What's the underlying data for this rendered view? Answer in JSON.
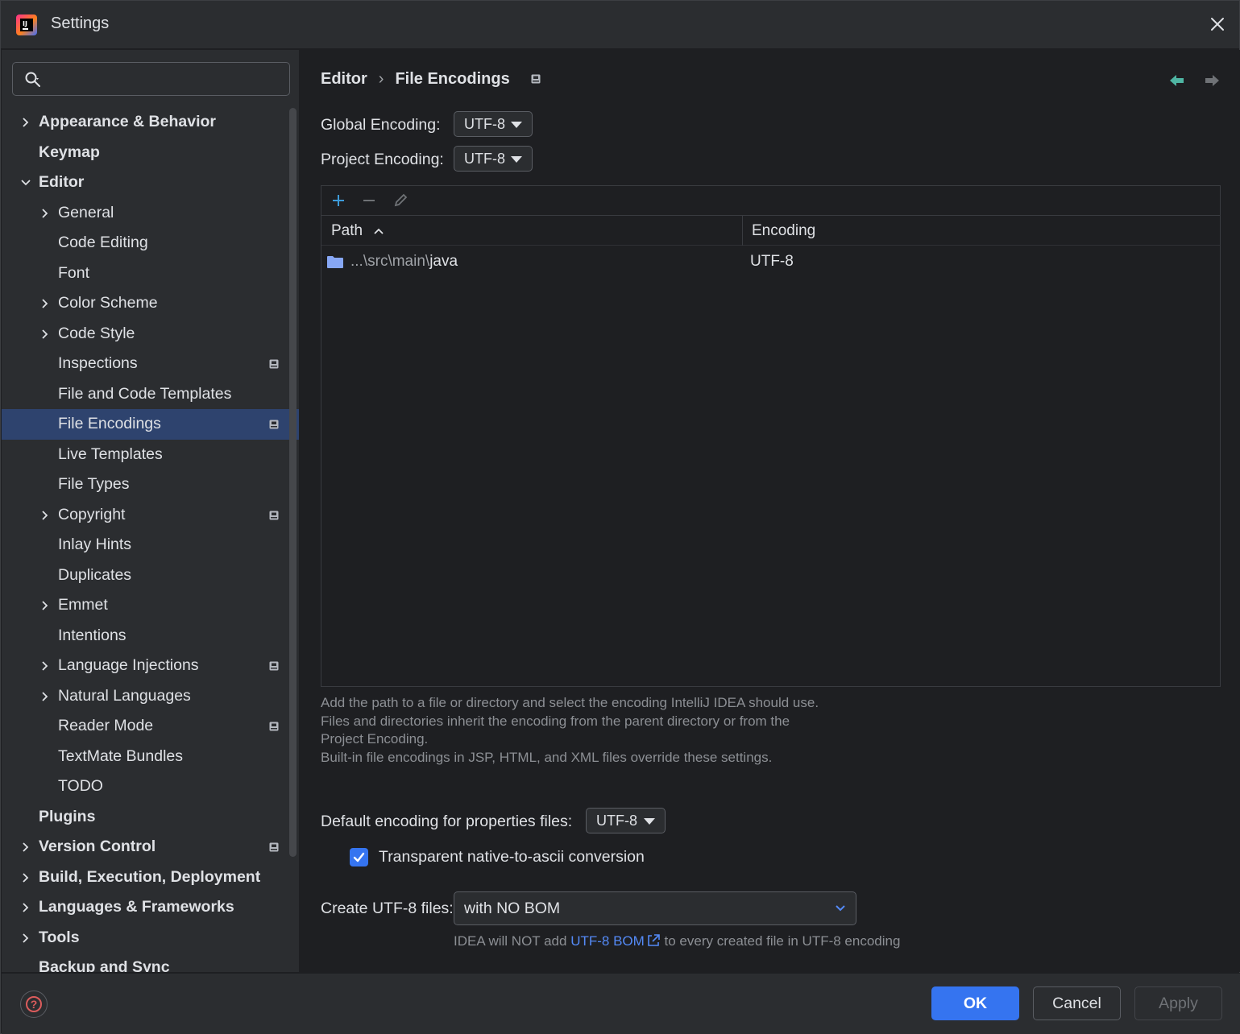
{
  "window": {
    "title": "Settings"
  },
  "search": {
    "placeholder": ""
  },
  "sidebar": {
    "items": [
      {
        "label": "Appearance & Behavior",
        "level": 0,
        "expander": "collapsed",
        "project": false
      },
      {
        "label": "Keymap",
        "level": 0,
        "expander": "none",
        "project": false
      },
      {
        "label": "Editor",
        "level": 0,
        "expander": "expanded",
        "project": false
      },
      {
        "label": "General",
        "level": 1,
        "expander": "collapsed",
        "project": false
      },
      {
        "label": "Code Editing",
        "level": 1,
        "expander": "none",
        "project": false
      },
      {
        "label": "Font",
        "level": 1,
        "expander": "none",
        "project": false
      },
      {
        "label": "Color Scheme",
        "level": 1,
        "expander": "collapsed",
        "project": false
      },
      {
        "label": "Code Style",
        "level": 1,
        "expander": "collapsed",
        "project": false
      },
      {
        "label": "Inspections",
        "level": 1,
        "expander": "none",
        "project": true
      },
      {
        "label": "File and Code Templates",
        "level": 1,
        "expander": "none",
        "project": false
      },
      {
        "label": "File Encodings",
        "level": 1,
        "expander": "none",
        "project": true,
        "selected": true
      },
      {
        "label": "Live Templates",
        "level": 1,
        "expander": "none",
        "project": false
      },
      {
        "label": "File Types",
        "level": 1,
        "expander": "none",
        "project": false
      },
      {
        "label": "Copyright",
        "level": 1,
        "expander": "collapsed",
        "project": true
      },
      {
        "label": "Inlay Hints",
        "level": 1,
        "expander": "none",
        "project": false
      },
      {
        "label": "Duplicates",
        "level": 1,
        "expander": "none",
        "project": false
      },
      {
        "label": "Emmet",
        "level": 1,
        "expander": "collapsed",
        "project": false
      },
      {
        "label": "Intentions",
        "level": 1,
        "expander": "none",
        "project": false
      },
      {
        "label": "Language Injections",
        "level": 1,
        "expander": "collapsed",
        "project": true
      },
      {
        "label": "Natural Languages",
        "level": 1,
        "expander": "collapsed",
        "project": false
      },
      {
        "label": "Reader Mode",
        "level": 1,
        "expander": "none",
        "project": true
      },
      {
        "label": "TextMate Bundles",
        "level": 1,
        "expander": "none",
        "project": false
      },
      {
        "label": "TODO",
        "level": 1,
        "expander": "none",
        "project": false
      },
      {
        "label": "Plugins",
        "level": 0,
        "expander": "none",
        "project": false
      },
      {
        "label": "Version Control",
        "level": 0,
        "expander": "collapsed",
        "project": true
      },
      {
        "label": "Build, Execution, Deployment",
        "level": 0,
        "expander": "collapsed",
        "project": false
      },
      {
        "label": "Languages & Frameworks",
        "level": 0,
        "expander": "collapsed",
        "project": false
      },
      {
        "label": "Tools",
        "level": 0,
        "expander": "collapsed",
        "project": false
      },
      {
        "label": "Backup and Sync",
        "level": 0,
        "expander": "none",
        "project": false
      }
    ]
  },
  "breadcrumb": {
    "parent": "Editor",
    "current": "File Encodings"
  },
  "global_encoding": {
    "label": "Global Encoding:",
    "value": "UTF-8"
  },
  "project_encoding": {
    "label": "Project Encoding:",
    "value": "UTF-8"
  },
  "table": {
    "columns": {
      "path": "Path",
      "encoding": "Encoding"
    },
    "rows": [
      {
        "path_prefix": "...\\src\\main\\",
        "path_name": "java",
        "encoding": "UTF-8"
      }
    ]
  },
  "help_text": {
    "line1": "Add the path to a file or directory and select the encoding IntelliJ IDEA should use.",
    "line2": "Files and directories inherit the encoding from the parent directory or from the Project Encoding.",
    "line3": "Built-in file encodings in JSP, HTML, and XML files override these settings."
  },
  "properties": {
    "label": "Default encoding for properties files:",
    "value": "UTF-8"
  },
  "native_to_ascii": {
    "label": "Transparent native-to-ascii conversion",
    "checked": true
  },
  "bom": {
    "label": "Create UTF-8 files:",
    "value": "with NO BOM",
    "note_prefix": "IDEA will NOT add ",
    "note_link": "UTF-8 BOM",
    "note_suffix": " to every created file in UTF-8 encoding"
  },
  "buttons": {
    "ok": "OK",
    "cancel": "Cancel",
    "apply": "Apply"
  },
  "colors": {
    "accent": "#3574f0",
    "selection": "#2e436e",
    "link": "#548af7",
    "nav_arrow": "#4fb5a3",
    "add_icon": "#3d9bd9",
    "folder": "#87a7f5"
  }
}
